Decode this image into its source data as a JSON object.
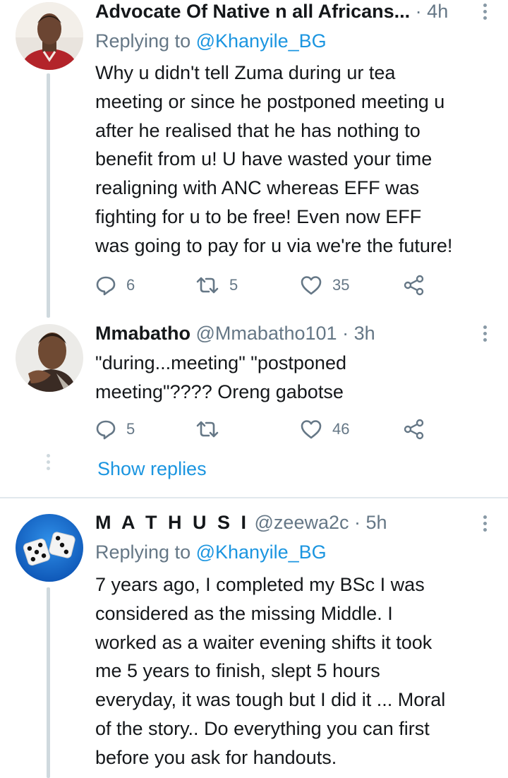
{
  "tweets": [
    {
      "name": "Advocate Of Native n all Africans...",
      "handle": "",
      "dot": "·",
      "time": "4h",
      "replying_label": "Replying to",
      "replying_to": "@Khanyile_BG",
      "text": "Why u didn't tell Zuma during ur tea\nmeeting or since he postponed meeting u\nafter he realised that he has nothing to\nbenefit from u! U have wasted your time\nrealigning with ANC whereas EFF was\nfighting for u to be free! Even now EFF\nwas going to pay for u via we're the future!",
      "replies": "6",
      "retweets": "5",
      "likes": "35"
    },
    {
      "name": "Mmabatho",
      "handle": "@Mmabatho101",
      "dot": "·",
      "time": "3h",
      "text": "\"during...meeting\" \"postponed\nmeeting\"???? Oreng gabotse",
      "replies": "5",
      "retweets": "",
      "likes": "46"
    },
    {
      "name": "M A T H U S I",
      "handle": "@zeewa2c",
      "dot": "·",
      "time": "5h",
      "replying_label": "Replying to",
      "replying_to": "@Khanyile_BG",
      "text": "7 years ago, I completed my BSc I was\nconsidered as the missing Middle. I\nworked as a waiter evening shifts it took\nme 5 years to finish, slept 5 hours\neveryday, it was tough but I did it ... Moral\nof the story..  Do everything you can first\nbefore you ask for handouts."
    }
  ],
  "show_replies": "Show replies",
  "icons": {
    "reply": "reply-icon",
    "retweet": "retweet-icon",
    "like": "heart-icon",
    "share": "share-icon",
    "more": "more-vertical-icon"
  },
  "colors": {
    "link": "#1b95e0",
    "muted": "#657786",
    "thread_line": "#cfd9de"
  }
}
